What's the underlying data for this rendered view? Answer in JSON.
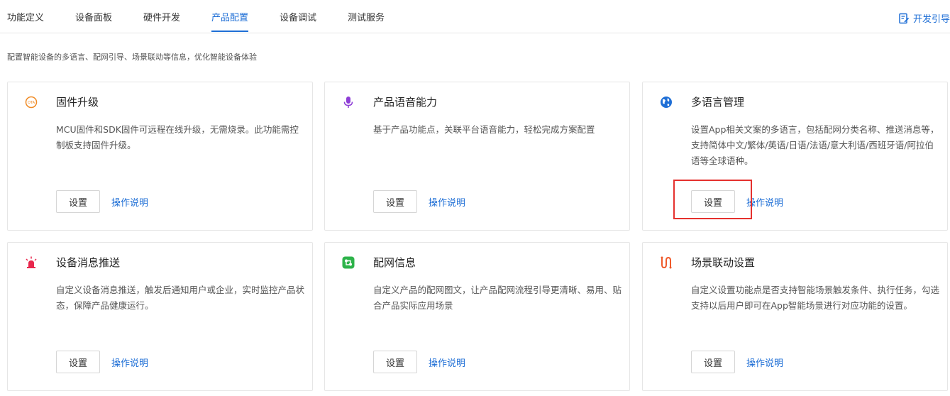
{
  "tabs": [
    {
      "label": "功能定义",
      "active": false
    },
    {
      "label": "设备面板",
      "active": false
    },
    {
      "label": "硬件开发",
      "active": false
    },
    {
      "label": "产品配置",
      "active": true
    },
    {
      "label": "设备调试",
      "active": false
    },
    {
      "label": "测试服务",
      "active": false
    }
  ],
  "guide_label": "开发引导",
  "subtitle": "配置智能设备的多语言、配网引导、场景联动等信息，优化智能设备体验",
  "accent": "#1f6fd6",
  "highlight_color": "#e5312e",
  "cards": [
    {
      "icon": "ota-icon",
      "icon_text": "OTA",
      "title": "固件升级",
      "desc": "MCU固件和SDK固件可远程在线升级，无需烧录。此功能需控制板支持固件升级。",
      "button": "设置",
      "link": "操作说明"
    },
    {
      "icon": "microphone-icon",
      "title": "产品语音能力",
      "desc": "基于产品功能点，关联平台语音能力，轻松完成方案配置",
      "button": "设置",
      "link": "操作说明"
    },
    {
      "icon": "globe-icon",
      "title": "多语言管理",
      "desc": "设置App相关文案的多语言，包括配网分类名称、推送消息等，支持简体中文/繁体/英语/日语/法语/意大利语/西班牙语/阿拉伯语等全球语种。",
      "button": "设置",
      "link": "操作说明"
    },
    {
      "icon": "alarm-light-icon",
      "title": "设备消息推送",
      "desc": "自定义设备消息推送，触发后通知用户或企业，实时监控产品状态，保障产品健康运行。",
      "button": "设置",
      "link": "操作说明"
    },
    {
      "icon": "network-config-icon",
      "title": "配网信息",
      "desc": "自定义产品的配网图文，让产品配网流程引导更清晰、易用、贴合产品实际应用场景",
      "button": "设置",
      "link": "操作说明"
    },
    {
      "icon": "scene-linkage-icon",
      "title": "场景联动设置",
      "desc": "自定义设置功能点是否支持智能场景触发条件、执行任务，勾选支持以后用户即可在App智能场景进行对应功能的设置。",
      "button": "设置",
      "link": "操作说明"
    }
  ]
}
